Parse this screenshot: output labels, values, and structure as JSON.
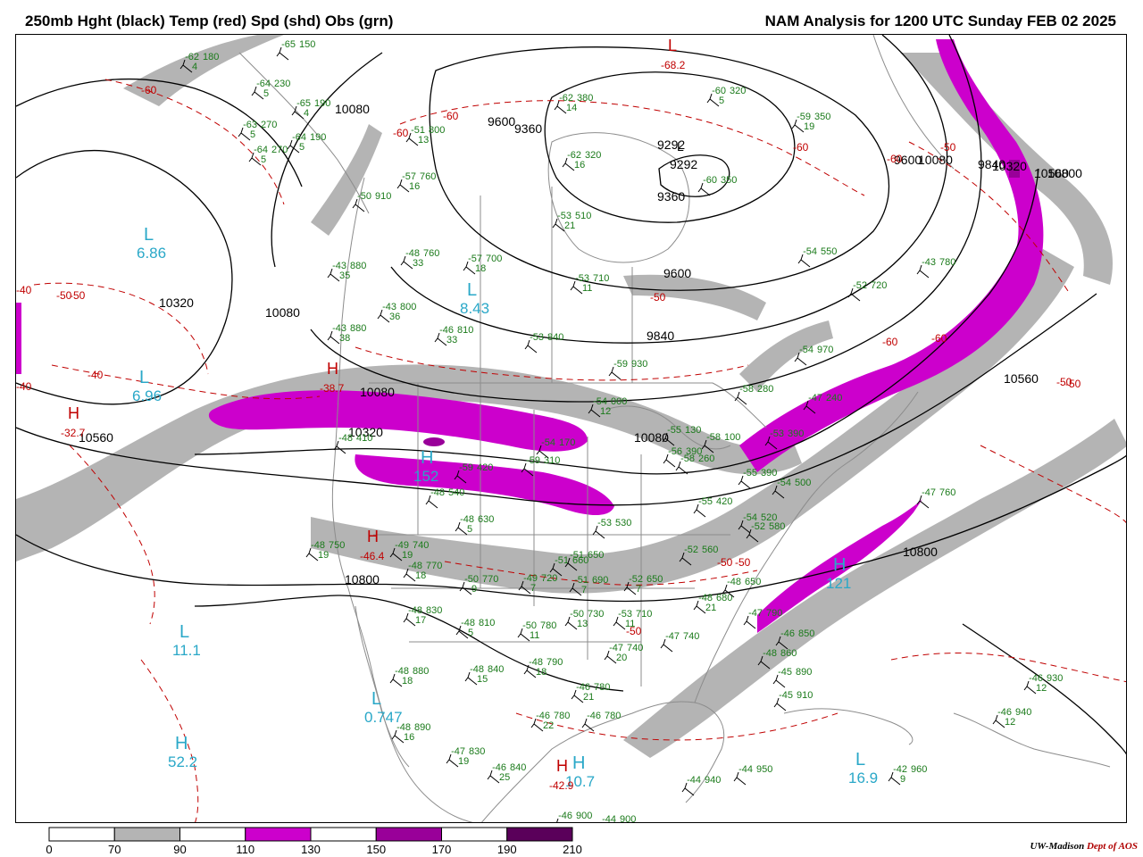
{
  "header": {
    "left_title": "250mb Hght (black) Temp (red) Spd (shd) Obs (grn)",
    "right_title": "NAM Analysis for 1200 UTC Sunday  FEB 02 2025"
  },
  "colors": {
    "height_contour": "#000000",
    "temp_contour": "#c00000",
    "obs_text": "#1a7a1a",
    "center_label": "#2aa8c8",
    "boundary": "#8c8c8c",
    "speed_70_90": "#b4b4b4",
    "speed_110_130": "#cc00cc",
    "speed_150_170": "#990099",
    "speed_190_210": "#5a005a"
  },
  "colorbar": {
    "ticks": [
      "0",
      "70",
      "90",
      "110",
      "130",
      "150",
      "170",
      "190",
      "210"
    ],
    "segments": [
      "#ffffff",
      "#b4b4b4",
      "#ffffff",
      "#cc00cc",
      "#ffffff",
      "#990099",
      "#ffffff",
      "#5a005a"
    ]
  },
  "credit": {
    "org": "UW-Madison",
    "dept": "Dept of AOS"
  },
  "height_labels": [
    "10080",
    "9600",
    "9360",
    "9292",
    "9360",
    "9600",
    "9840",
    "10080",
    "10320",
    "10080",
    "10320",
    "10560",
    "10080",
    "10560",
    "10800",
    "10800",
    "10560",
    "10800",
    "10320",
    "9840",
    "10080",
    "9600"
  ],
  "temp_labels": [
    "-60",
    "-60",
    "-60",
    "-60",
    "-60",
    "-50",
    "-50",
    "-40",
    "-40",
    "-40",
    "-50",
    "-50",
    "-50",
    "-50",
    "-60",
    "-50",
    "-50",
    "-60",
    "-50"
  ],
  "pressure_centers": [
    {
      "letter": "L",
      "value": "6.86",
      "kind": "speed"
    },
    {
      "letter": "L",
      "value": "6.96",
      "kind": "speed"
    },
    {
      "letter": "L",
      "value": "8.43",
      "kind": "speed"
    },
    {
      "letter": "L",
      "value": "11.1",
      "kind": "speed"
    },
    {
      "letter": "L",
      "value": "0.747",
      "kind": "speed"
    },
    {
      "letter": "H",
      "value": "52.2",
      "kind": "speed"
    },
    {
      "letter": "L",
      "value": "16.9",
      "kind": "speed"
    },
    {
      "letter": "H",
      "value": "10.7",
      "kind": "speed"
    },
    {
      "letter": "H",
      "value": "152",
      "kind": "speed"
    },
    {
      "letter": "H",
      "value": "121",
      "kind": "speed"
    },
    {
      "letter": "L",
      "value": "-68.2",
      "kind": "temp"
    },
    {
      "letter": "H",
      "value": "-38.7",
      "kind": "temp"
    },
    {
      "letter": "H",
      "value": "-32.7",
      "kind": "temp"
    },
    {
      "letter": "H",
      "value": "-46.4",
      "kind": "temp"
    },
    {
      "letter": "H",
      "value": "-42.9",
      "kind": "temp"
    },
    {
      "letter": "L",
      "value": "9292",
      "kind": "height"
    }
  ],
  "stations": [
    {
      "temp": "-62",
      "dew": "4",
      "hgt": "180"
    },
    {
      "temp": "-65",
      "dew": "",
      "hgt": "150"
    },
    {
      "temp": "-64",
      "dew": "5",
      "hgt": "230"
    },
    {
      "temp": "-65",
      "dew": "4",
      "hgt": "190"
    },
    {
      "temp": "-63",
      "dew": "5",
      "hgt": "270"
    },
    {
      "temp": "-64",
      "dew": "5",
      "hgt": "190"
    },
    {
      "temp": "-64",
      "dew": "5",
      "hgt": "270"
    },
    {
      "temp": "-51",
      "dew": "13",
      "hgt": "800"
    },
    {
      "temp": "-57",
      "dew": "16",
      "hgt": "760"
    },
    {
      "temp": "-62",
      "dew": "14",
      "hgt": "380"
    },
    {
      "temp": "-62",
      "dew": "16",
      "hgt": "320"
    },
    {
      "temp": "-60",
      "dew": "5",
      "hgt": "320"
    },
    {
      "temp": "-59",
      "dew": "19",
      "hgt": "350"
    },
    {
      "temp": "-60",
      "dew": "",
      "hgt": "350"
    },
    {
      "temp": "-53",
      "dew": "21",
      "hgt": "510"
    },
    {
      "temp": "-50",
      "dew": "",
      "hgt": "910"
    },
    {
      "temp": "-43",
      "dew": "35",
      "hgt": "880"
    },
    {
      "temp": "-48",
      "dew": "33",
      "hgt": "760"
    },
    {
      "temp": "-57",
      "dew": "18",
      "hgt": "700"
    },
    {
      "temp": "-43",
      "dew": "36",
      "hgt": "800"
    },
    {
      "temp": "-53",
      "dew": "11",
      "hgt": "710"
    },
    {
      "temp": "-54",
      "dew": "",
      "hgt": "550"
    },
    {
      "temp": "-52",
      "dew": "",
      "hgt": "720"
    },
    {
      "temp": "-43",
      "dew": "",
      "hgt": "780"
    },
    {
      "temp": "-43",
      "dew": "38",
      "hgt": "880"
    },
    {
      "temp": "-46",
      "dew": "33",
      "hgt": "810"
    },
    {
      "temp": "-53",
      "dew": "",
      "hgt": "840"
    },
    {
      "temp": "-59",
      "dew": "",
      "hgt": "930"
    },
    {
      "temp": "-54",
      "dew": "12",
      "hgt": "000"
    },
    {
      "temp": "-55",
      "dew": "",
      "hgt": "130"
    },
    {
      "temp": "-48",
      "dew": "",
      "hgt": "410"
    },
    {
      "temp": "-59",
      "dew": "",
      "hgt": "420"
    },
    {
      "temp": "-59",
      "dew": "",
      "hgt": "310"
    },
    {
      "temp": "-48",
      "dew": "",
      "hgt": "540"
    },
    {
      "temp": "-48",
      "dew": "5",
      "hgt": "630"
    },
    {
      "temp": "-48",
      "dew": "19",
      "hgt": "750"
    },
    {
      "temp": "-49",
      "dew": "19",
      "hgt": "740"
    },
    {
      "temp": "-48",
      "dew": "18",
      "hgt": "770"
    },
    {
      "temp": "-50",
      "dew": "9",
      "hgt": "770"
    },
    {
      "temp": "-49",
      "dew": "7",
      "hgt": "720"
    },
    {
      "temp": "-51",
      "dew": "7",
      "hgt": "690"
    },
    {
      "temp": "-52",
      "dew": "7",
      "hgt": "650"
    },
    {
      "temp": "-48",
      "dew": "17",
      "hgt": "830"
    },
    {
      "temp": "-48",
      "dew": "5",
      "hgt": "810"
    },
    {
      "temp": "-50",
      "dew": "11",
      "hgt": "780"
    },
    {
      "temp": "-50",
      "dew": "13",
      "hgt": "730"
    },
    {
      "temp": "-53",
      "dew": "11",
      "hgt": "710"
    },
    {
      "temp": "-48",
      "dew": "18",
      "hgt": "880"
    },
    {
      "temp": "-48",
      "dew": "15",
      "hgt": "840"
    },
    {
      "temp": "-48",
      "dew": "18",
      "hgt": "790"
    },
    {
      "temp": "-46",
      "dew": "21",
      "hgt": "780"
    },
    {
      "temp": "-46",
      "dew": "22",
      "hgt": "780"
    },
    {
      "temp": "-46",
      "dew": "",
      "hgt": "780"
    },
    {
      "temp": "-48",
      "dew": "16",
      "hgt": "890"
    },
    {
      "temp": "-47",
      "dew": "19",
      "hgt": "830"
    },
    {
      "temp": "-46",
      "dew": "25",
      "hgt": "840"
    },
    {
      "temp": "-46",
      "dew": "",
      "hgt": "900"
    },
    {
      "temp": "-44",
      "dew": "",
      "hgt": "900"
    },
    {
      "temp": "-47",
      "dew": "20",
      "hgt": "740"
    },
    {
      "temp": "-47",
      "dew": "",
      "hgt": "740"
    },
    {
      "temp": "-47",
      "dew": "",
      "hgt": "790"
    },
    {
      "temp": "-46",
      "dew": "",
      "hgt": "850"
    },
    {
      "temp": "-48",
      "dew": "",
      "hgt": "860"
    },
    {
      "temp": "-45",
      "dew": "",
      "hgt": "890"
    },
    {
      "temp": "-45",
      "dew": "",
      "hgt": "910"
    },
    {
      "temp": "-46",
      "dew": "12",
      "hgt": "930"
    },
    {
      "temp": "-46",
      "dew": "12",
      "hgt": "940"
    },
    {
      "temp": "-44",
      "dew": "",
      "hgt": "940"
    },
    {
      "temp": "-44",
      "dew": "",
      "hgt": "950"
    },
    {
      "temp": "-42",
      "dew": "9",
      "hgt": "960"
    },
    {
      "temp": "-47",
      "dew": "",
      "hgt": "760"
    },
    {
      "temp": "-54",
      "dew": "",
      "hgt": "520"
    },
    {
      "temp": "-55",
      "dew": "",
      "hgt": "420"
    },
    {
      "temp": "-55",
      "dew": "",
      "hgt": "390"
    },
    {
      "temp": "-48",
      "dew": "21",
      "hgt": "680"
    },
    {
      "temp": "-48",
      "dew": "",
      "hgt": "650"
    },
    {
      "temp": "-52",
      "dew": "",
      "hgt": "560"
    },
    {
      "temp": "-54",
      "dew": "",
      "hgt": "500"
    },
    {
      "temp": "-54",
      "dew": "",
      "hgt": "970"
    },
    {
      "temp": "-58",
      "dew": "",
      "hgt": "280"
    },
    {
      "temp": "-58",
      "dew": "",
      "hgt": "260"
    },
    {
      "temp": "-53",
      "dew": "",
      "hgt": "390"
    },
    {
      "temp": "-47",
      "dew": "",
      "hgt": "240"
    },
    {
      "temp": "-54",
      "dew": "",
      "hgt": "170"
    },
    {
      "temp": "-52",
      "dew": "",
      "hgt": "580"
    },
    {
      "temp": "-51",
      "dew": "",
      "hgt": "660"
    },
    {
      "temp": "-51",
      "dew": "",
      "hgt": "650"
    },
    {
      "temp": "-53",
      "dew": "",
      "hgt": "530"
    },
    {
      "temp": "-56",
      "dew": "",
      "hgt": "390"
    },
    {
      "temp": "-58",
      "dew": "",
      "hgt": "100"
    }
  ]
}
